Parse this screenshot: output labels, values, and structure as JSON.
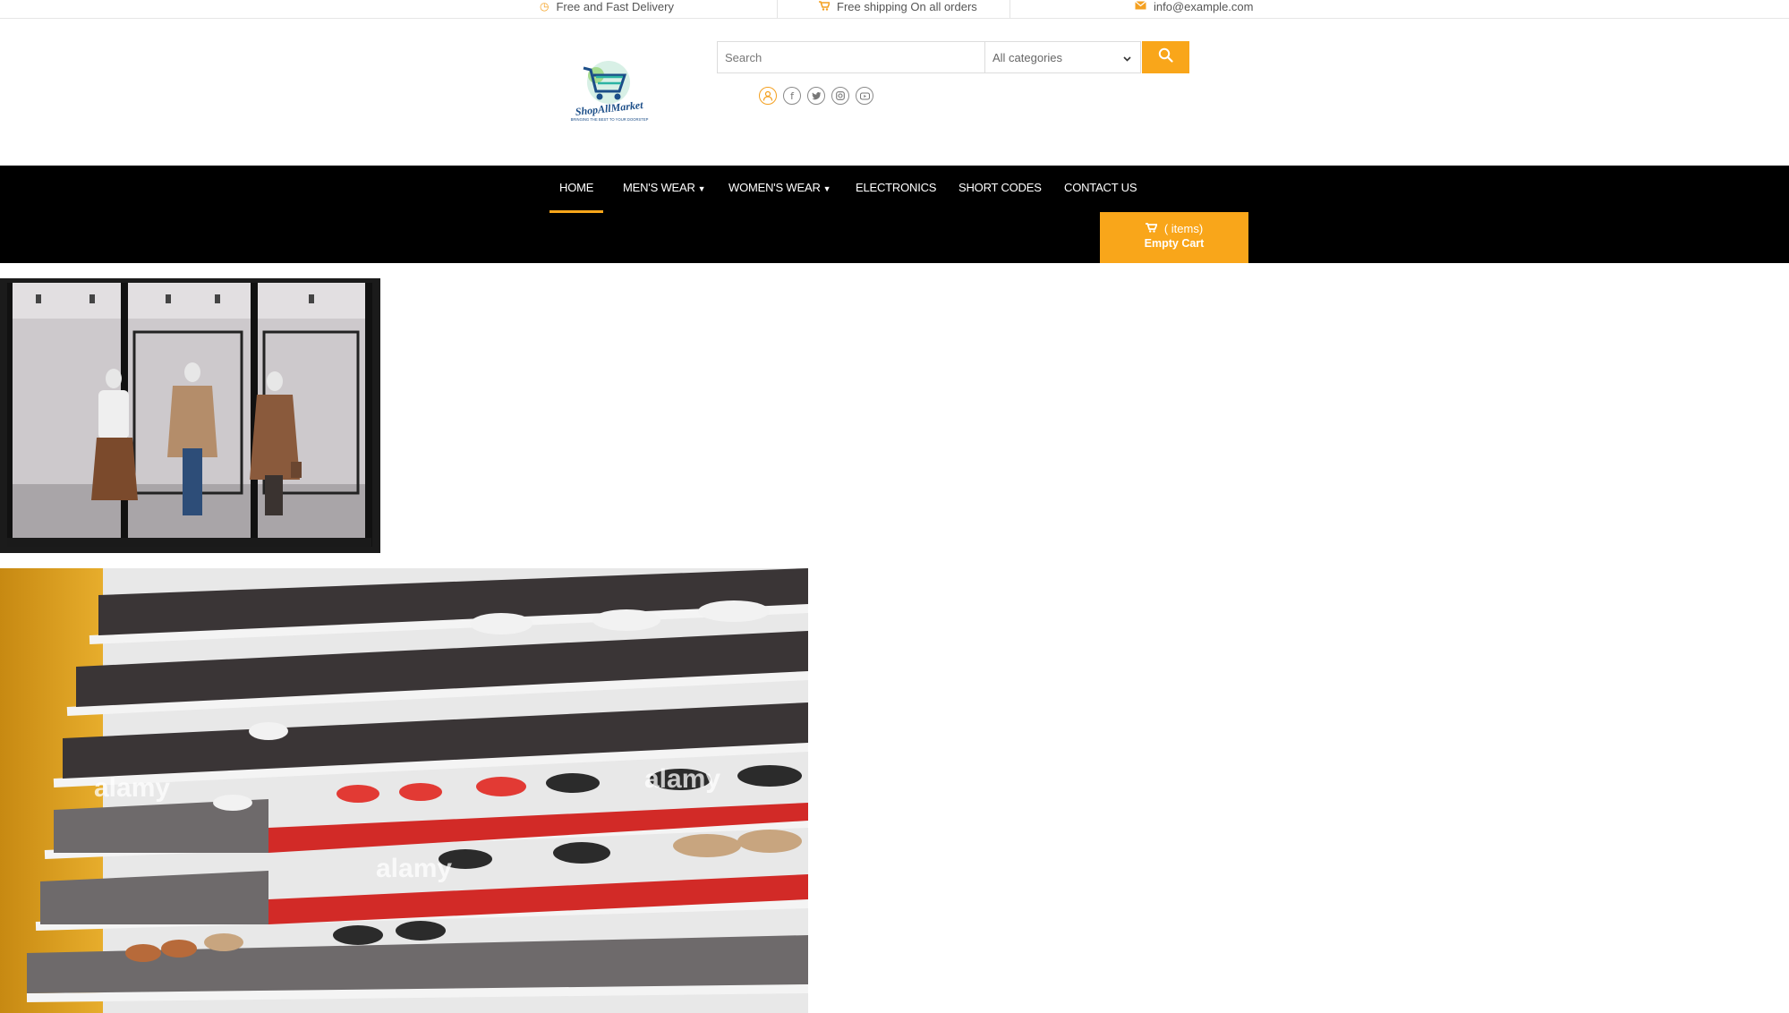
{
  "topbar": {
    "delivery": "Free and Fast Delivery",
    "shipping": "Free shipping On all orders",
    "email": "info@example.com"
  },
  "logo": {
    "name": "ShopAllMarket",
    "tagline": "BRINGING THE BEST TO YOUR DOORSTEP"
  },
  "search": {
    "placeholder": "Search",
    "category_selected": "All categories"
  },
  "nav": {
    "items": [
      {
        "label": "HOME",
        "active": true
      },
      {
        "label": "MEN'S WEAR",
        "dropdown": true
      },
      {
        "label": "WOMEN'S WEAR",
        "dropdown": true
      },
      {
        "label": "ELECTRONICS"
      },
      {
        "label": "SHORT CODES"
      },
      {
        "label": "CONTACT US"
      }
    ]
  },
  "cart": {
    "items_label": "( items)",
    "status": "Empty Cart"
  },
  "images": {
    "shoe_watermark": "alamy"
  },
  "colors": {
    "accent": "#f9a61a",
    "nav_bg": "#000000"
  },
  "icons": {
    "topbar": [
      "clock-icon",
      "cart-icon",
      "mail-icon"
    ],
    "socials": [
      "user-icon",
      "facebook-icon",
      "twitter-icon",
      "instagram-icon",
      "youtube-icon"
    ]
  }
}
